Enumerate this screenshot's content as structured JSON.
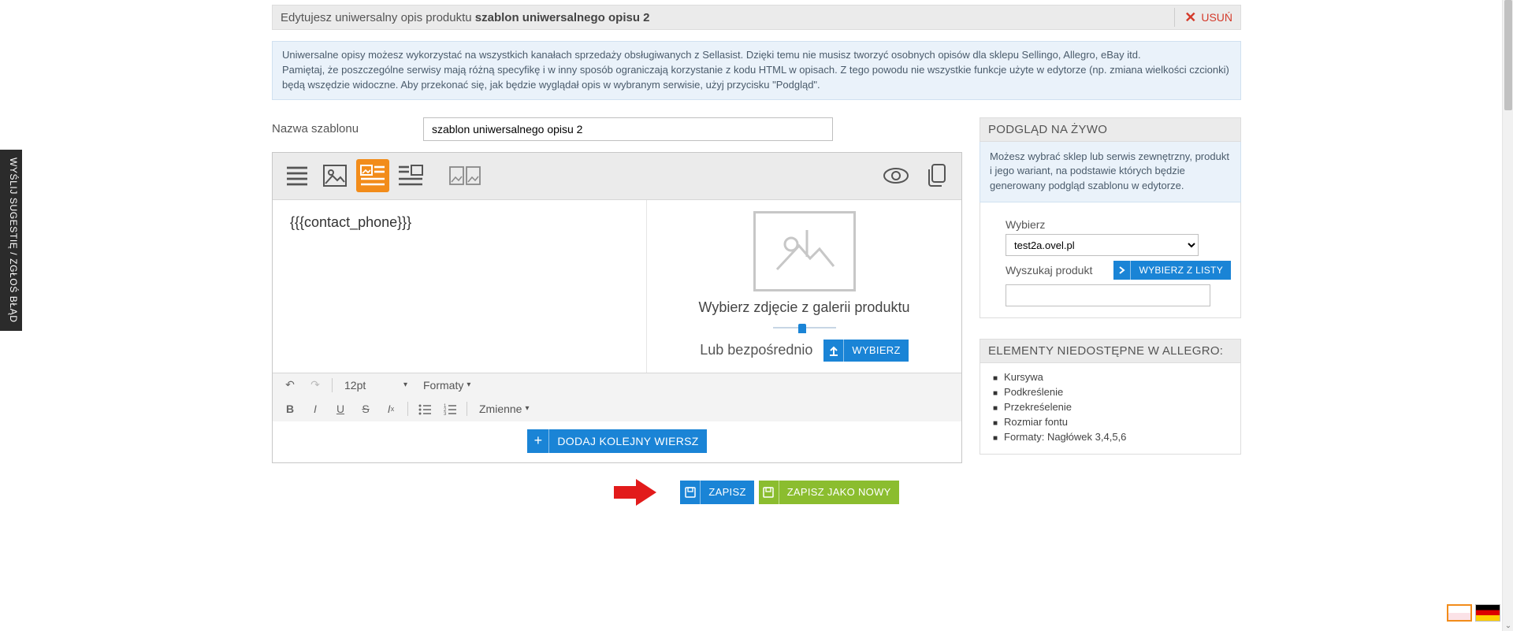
{
  "header": {
    "title_prefix": "Edytujesz uniwersalny opis produktu ",
    "title_bold": "szablon uniwersalnego opisu 2",
    "delete": "USUŃ"
  },
  "info_lines": [
    "Uniwersalne opisy możesz wykorzystać na wszystkich kanałach sprzedaży obsługiwanych z Sellasist. Dzięki temu nie musisz tworzyć osobnych opisów dla sklepu Sellingo, Allegro, eBay itd.",
    "Pamiętaj, że poszczególne serwisy mają różną specyfikę i w inny sposób ograniczają korzystanie z kodu HTML w opisach. Z tego powodu nie wszystkie funkcje użyte w edytorze (np. zmiana wielkości czcionki) będą wszędzie widoczne. Aby przekonać się, jak będzie wyglądał opis w wybranym serwisie, użyj przycisku \"Podgląd\"."
  ],
  "template_name": {
    "label": "Nazwa szablonu",
    "value": "szablon uniwersalnego opisu 2"
  },
  "editor": {
    "content": "{{{contact_phone}}}",
    "img_caption": "Wybierz zdjęcie z galerii produktu",
    "or_text": "Lub bezpośrednio",
    "choose": "WYBIERZ",
    "add_row": "DODAJ KOLEJNY WIERSZ",
    "font_size": "12pt",
    "formats": "Formaty",
    "variables": "Zmienne"
  },
  "preview": {
    "header": "PODGLĄD NA ŻYWO",
    "info": "Możesz wybrać sklep lub serwis zewnętrzny, produkt i jego wariant, na podstawie których będzie generowany podgląd szablonu w edytorze.",
    "select_label": "Wybierz",
    "select_value": "test2a.ovel.pl",
    "search_label": "Wyszukaj produkt",
    "list_btn": "WYBIERZ Z LISTY"
  },
  "unavailable": {
    "header": "ELEMENTY NIEDOSTĘPNE W ALLEGRO:",
    "items": [
      "Kursywa",
      "Podkreślenie",
      "Przekreśelenie",
      "Rozmiar fontu",
      "Formaty: Nagłówek 3,4,5,6"
    ]
  },
  "buttons": {
    "save": "ZAPISZ",
    "save_as_new": "ZAPISZ JAKO NOWY"
  },
  "side_tab": "WYŚLIJ SUGESTIĘ / ZGŁOŚ BŁĄD"
}
